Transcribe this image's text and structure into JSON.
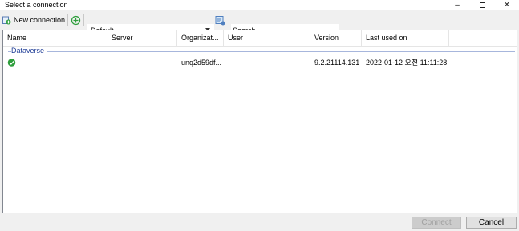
{
  "window": {
    "title": "Select a connection",
    "min": "–",
    "close": "✕"
  },
  "toolbar": {
    "new_connection": "New connection",
    "profile": "Default",
    "search_label": "Search"
  },
  "columns": [
    "Name",
    "Server",
    "Organizat...",
    "User",
    "Version",
    "Last used on"
  ],
  "group": {
    "name": "Dataverse"
  },
  "rows": [
    {
      "name": "",
      "server": "",
      "organization": "unq2d59df...",
      "user": "",
      "version": "9.2.21114.131",
      "last_used": "2022-01-12 오전 11:11:28"
    }
  ],
  "buttons": {
    "connect": "Connect",
    "cancel": "Cancel"
  },
  "colors": {
    "accent": "#1e3c96",
    "connected": "#2e9e3c"
  }
}
